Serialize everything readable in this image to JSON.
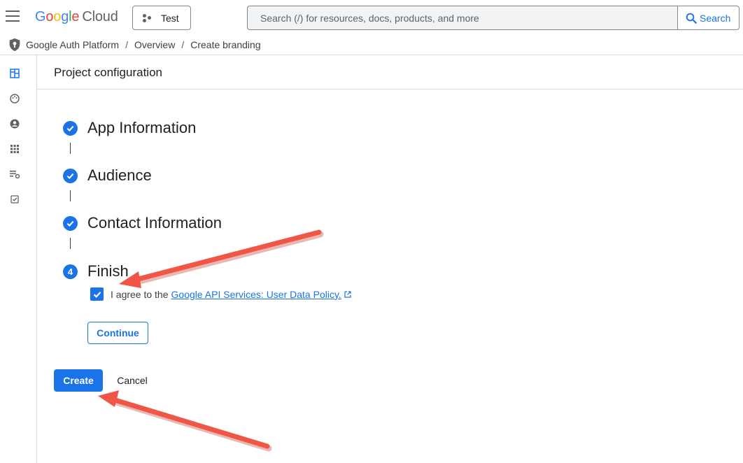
{
  "header": {
    "logo": {
      "g": "G",
      "o1": "o",
      "o2": "o",
      "g2": "g",
      "l": "l",
      "e": "e",
      "cloud": "Cloud"
    },
    "project": "Test",
    "search_placeholder": "Search (/) for resources, docs, products, and more",
    "search_button": "Search"
  },
  "breadcrumb": {
    "items": [
      "Google Auth Platform",
      "Overview",
      "Create branding"
    ],
    "separator": "/"
  },
  "rail": {
    "icons": [
      "dashboard-icon",
      "palette-icon",
      "account-circle-icon",
      "apps-grid-icon",
      "settings-list-icon",
      "checklist-icon"
    ]
  },
  "page": {
    "title": "Project configuration"
  },
  "steps": [
    {
      "label": "App Information",
      "state": "done"
    },
    {
      "label": "Audience",
      "state": "done"
    },
    {
      "label": "Contact Information",
      "state": "done"
    },
    {
      "label": "Finish",
      "state": "current",
      "number": "4"
    }
  ],
  "agreement": {
    "prefix": "I agree to the",
    "link": "Google API Services: User Data Policy.",
    "checked": true
  },
  "buttons": {
    "continue": "Continue",
    "create": "Create",
    "cancel": "Cancel"
  },
  "colors": {
    "accent": "#1a73e8",
    "annotation_arrow": "#f05545"
  }
}
